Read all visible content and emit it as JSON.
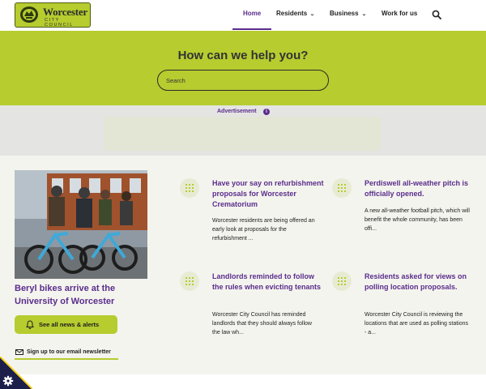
{
  "brand": {
    "name": "Worcester",
    "subtitle": "CITY COUNCIL",
    "colors": {
      "lime": "#b6cc2f",
      "purple": "#5a2d8c",
      "ad_grey": "#e4e4e2",
      "page_bg": "#f4f4ee"
    }
  },
  "nav": {
    "items": [
      {
        "label": "Home",
        "active": true
      },
      {
        "label": "Residents",
        "has_dropdown": true
      },
      {
        "label": "Business",
        "has_dropdown": true
      },
      {
        "label": "Work for us"
      }
    ],
    "search_icon": "search-icon"
  },
  "help": {
    "title": "How can we help you?",
    "search_placeholder": "Search"
  },
  "advert": {
    "label": "Advertisement",
    "info_glyph": "i"
  },
  "featured": {
    "image": "photo-people-with-beryl-bikes",
    "title": "Beryl bikes arrive at the University of Worcester",
    "news_button": "See all news & alerts",
    "news_icon": "bell-icon",
    "newsletter_link": "Sign up to our email newsletter",
    "newsletter_icon": "envelope-icon"
  },
  "cards": [
    {
      "title": "Have your say on refurbishment proposals for Worcester Crematorium",
      "body": "Worcester residents are being offered an early look at proposals for the refurbishment ..."
    },
    {
      "title": "Perdiswell all-weather pitch is officially opened.",
      "body": "A new all-weather football pitch, which will benefit the whole community, has been offi..."
    },
    {
      "title": "Landlords reminded to follow the rules when evicting tenants",
      "body": "Worcester City Council has reminded landlords that they should always follow the law wh..."
    },
    {
      "title": "Residents asked for views on polling location proposals.",
      "body": "Worcester City Council is reviewing the locations that are used as polling stations - a..."
    }
  ],
  "cookie": {
    "icon": "gear-icon"
  }
}
